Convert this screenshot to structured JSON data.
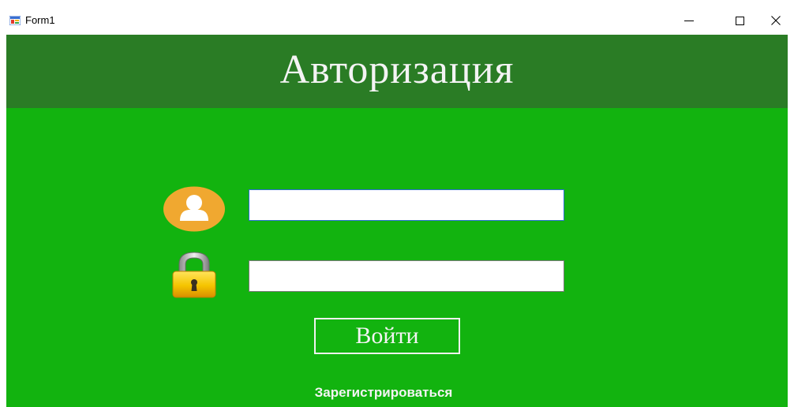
{
  "window": {
    "title": "Form1",
    "icon": "winforms-app-icon",
    "controls": {
      "minimize": "minimize-icon",
      "maximize": "maximize-icon",
      "close": "close-icon"
    }
  },
  "form": {
    "heading": "Авторизация",
    "login_field": {
      "value": "",
      "icon": "user-icon"
    },
    "password_field": {
      "value": "",
      "icon": "lock-icon"
    },
    "submit_label": "Войти",
    "register_link": "Зарегистрироваться"
  },
  "colors": {
    "background": "#12b30f",
    "header": "#2a7c25",
    "text": "#f4f4f4",
    "user_icon": "#f0a830",
    "lock_body": "#f5c400"
  }
}
